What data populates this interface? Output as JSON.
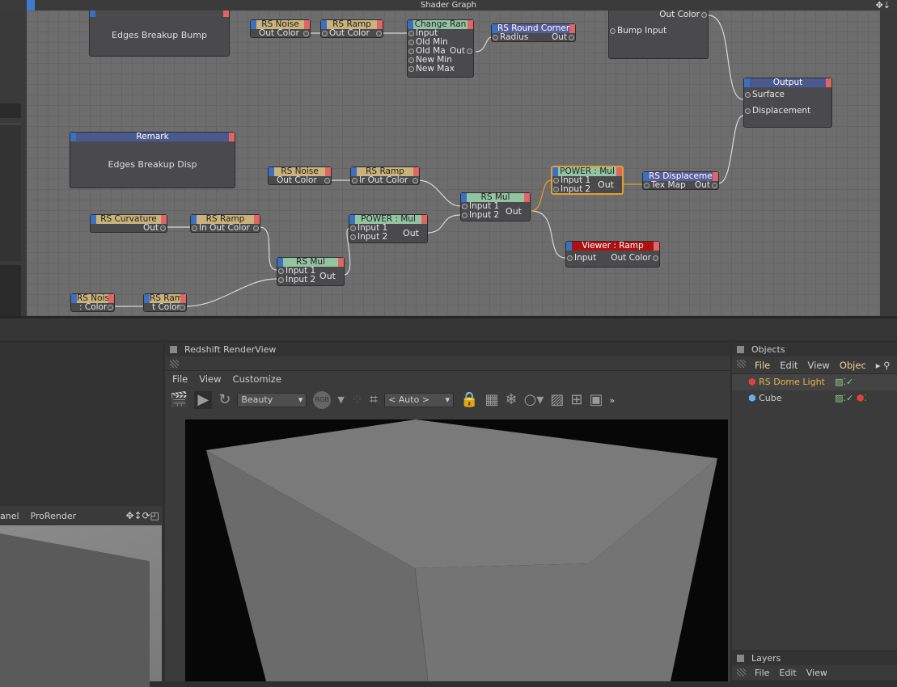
{
  "shader_graph": {
    "title": "Shader Graph",
    "nodes": {
      "remark_bump": {
        "title": "",
        "text": "Edges Breakup Bump"
      },
      "noise1": {
        "title": "RS Noise",
        "port": "Out Color"
      },
      "ramp1": {
        "title": "RS Ramp",
        "port": "Out Color"
      },
      "change_range": {
        "title": "Change Ran",
        "ports": [
          "Input",
          "Old Min",
          "Old Ma",
          "New Min",
          "New Max"
        ],
        "out": "Out"
      },
      "round_corners": {
        "title": "RS Round Corners",
        "in": "Radius",
        "out": "Out"
      },
      "bump_node": {
        "out": "Out Color",
        "in": "Bump Input"
      },
      "output": {
        "title": "Output",
        "ports": [
          "Surface",
          "Displacement"
        ]
      },
      "remark_disp": {
        "title": "Remark",
        "text": "Edges Breakup Disp"
      },
      "noise2": {
        "title": "RS Noise",
        "port": "Out Color"
      },
      "ramp2": {
        "title": "RS Ramp",
        "port": "lr Out Color"
      },
      "mul1": {
        "title": "RS Mul",
        "ports": [
          "Input 1",
          "Input 2"
        ],
        "out": "Out"
      },
      "power1": {
        "title": "POWER : Mul",
        "ports": [
          "Input 1",
          "Input 2"
        ],
        "out": "Out"
      },
      "displacement": {
        "title": "RS Displacement",
        "in": "Tex Map",
        "out": "Out"
      },
      "viewer": {
        "title": "Viewer : Ramp",
        "in": "Input",
        "out": "Out Color"
      },
      "curvature": {
        "title": "RS Curvature",
        "out": "Out"
      },
      "ramp3": {
        "title": "RS Ramp",
        "port": "In Out Color"
      },
      "power2": {
        "title": "POWER : Mul",
        "ports": [
          "Input 1",
          "Input 2"
        ],
        "out": "Out"
      },
      "mul2": {
        "title": "RS Mul",
        "ports": [
          "Input 1",
          "Input 2"
        ],
        "out": "Out"
      },
      "noise3": {
        "title": "RS Noise",
        "port": ": Color"
      },
      "ramp4": {
        "title": "RS Ramp",
        "port": "t Color"
      }
    }
  },
  "left_panel": {
    "tabs": [
      "anel",
      "ProRender"
    ]
  },
  "renderview": {
    "title": "Redshift RenderView",
    "menu": [
      "File",
      "View",
      "Customize"
    ],
    "aov": "Beauty",
    "rgb": "RGB",
    "size": "< Auto >",
    "more": "»"
  },
  "objects": {
    "title": "Objects",
    "menu": [
      "File",
      "Edit",
      "View",
      "Objec"
    ],
    "items": [
      {
        "name": "RS Dome Light",
        "color": "#e8b64a"
      },
      {
        "name": "Cube",
        "color": "#c8c8c8"
      }
    ]
  },
  "layers": {
    "title": "Layers",
    "menu": [
      "File",
      "Edit",
      "View"
    ]
  },
  "colors": {
    "accent_selected": "#e0a030",
    "node_tan": "#c9b27b",
    "node_green": "#93c4a2",
    "viewer_red": "#b01010"
  }
}
